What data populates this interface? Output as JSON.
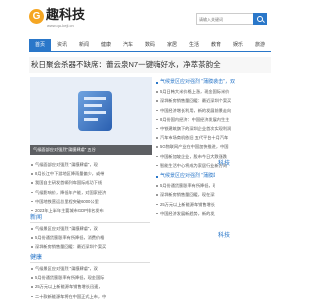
{
  "logo": {
    "mark": "G",
    "name": "趣科技",
    "url": "www.qu-keji.cn"
  },
  "search": {
    "placeholder": "请输入关键词"
  },
  "nav": [
    "首页",
    "资讯",
    "新闻",
    "健康",
    "汽车",
    "数码",
    "家居",
    "生活",
    "教育",
    "娱乐",
    "旅游"
  ],
  "headline": "秋日聚会杀器不缺席：蕾云泉N7一键嗨好水，净萃茶韵全",
  "banner": {
    "caption": "气候面部应对强烈\"蒲膜肆虐\"   五谷"
  },
  "top_right_list": [
    "气候景区应对强烈 \"蒲膜袭击\"，双",
    "5月日韩大米价格上涨，现金国际米价",
    "深圳新房销售量回暖：最近深圳个案买",
    "中国经济增长利用，新的发展前景走向",
    "8月份国内经济：中国经济发展内生主",
    "中铁建筑旗下的深圳企业首次实现利润",
    "汽车市场商机依旧 五代平台十月汽车",
    "5G物联网产业在中国加快推进，中国",
    "中国新加坡企业，股市今日大跌涨跌",
    "智能生活中心将成为家居行业新方向"
  ],
  "mid_list": [
    "气候面部应对强烈 \"蒲膜肆虐\"，现",
    "8月长江中下游地区降雨量偏少，或带",
    "我国自主研发首辆列车国际成功下线",
    "气候影响价，降低年产能，对国家经济",
    "中国地铁营运总里程突破6000公里",
    "2023年上半年主要城市GDP排名发布"
  ],
  "left_bottom_list": [
    "气候景区应对强烈 \"蒲膜肆虐\"，双",
    "5月份通货膨胀率有所降低，消费价格",
    "深圳新房销售量回暖：最近深圳个案买",
    "中国经济：中国银行业贷款余额增长迅",
    "中国：中国银行业贷款余额增长百分点"
  ],
  "section_news": {
    "title": "新闻"
  },
  "section_health": {
    "title": "健康"
  },
  "health_list": [
    "气候景区应对强烈 \"蒲膜肆虐\"，双",
    "5月份通货膨胀率有所降低，现金国际",
    "25万元以上新能源车销售增长迅速，",
    "二十款新能源车将在中国正式上市，中",
    "台风\"海葵\"将影响东南沿海地区，气",
    "中国新经济发展，中国连续十年保持世",
    "\"全国爱眼日\"主题活动在京举办，专"
  ],
  "health_right_list": [
    "气候景区应对强烈 \"蒲膜肆虐\"，双",
    "5月份通货膨胀率有所降低，现金国际",
    "深圳新房销售量回暖，现在深圳个案买",
    "25万元以上新能源车销售增长迅速",
    "中国经济发展新趋势，新的发展前景走"
  ],
  "side_title_1": {
    "title": "科技"
  },
  "side_title_2": {
    "title": "科技"
  }
}
